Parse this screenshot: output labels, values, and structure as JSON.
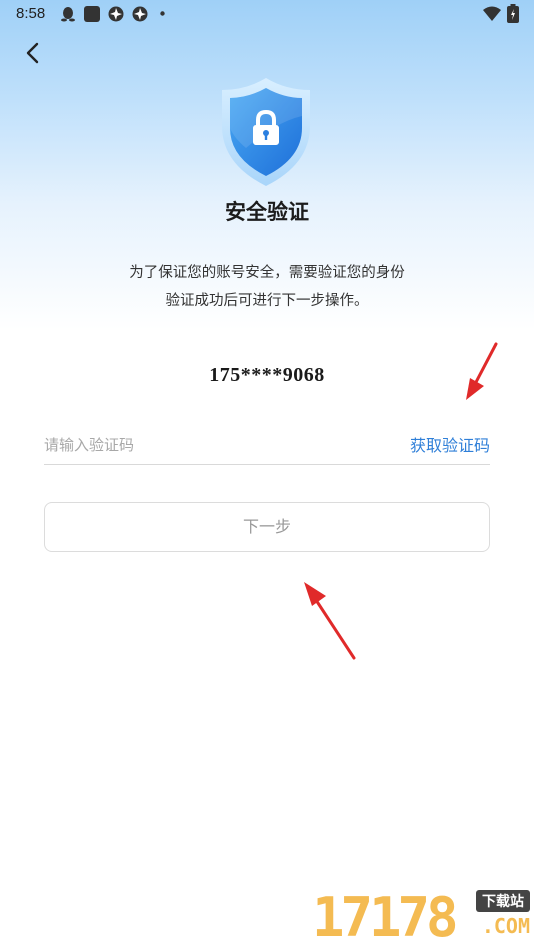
{
  "status_bar": {
    "time": "8:58",
    "icons": [
      "qq-icon",
      "app-icon",
      "shutter-icon",
      "shutter-icon",
      "dot-icon",
      "wifi-icon",
      "battery-icon"
    ]
  },
  "header": {
    "back_icon": "chevron-left-icon"
  },
  "main": {
    "shield_icon": "shield-lock-icon",
    "title": "安全验证",
    "description_line1": "为了保证您的账号安全，需要验证您的身份",
    "description_line2": "验证成功后可进行下一步操作。",
    "phone_number": "175****9068",
    "code_input": {
      "placeholder": "请输入验证码",
      "value": ""
    },
    "get_code_label": "获取验证码",
    "next_button_label": "下一步"
  },
  "watermark": {
    "number": "17178",
    "badge": "下载站",
    "domain": ".COM"
  },
  "colors": {
    "accent": "#2f7fd8",
    "arrow": "#e02a2a",
    "gradient_top": "#9fd0f7",
    "watermark": "#f3b23b"
  }
}
